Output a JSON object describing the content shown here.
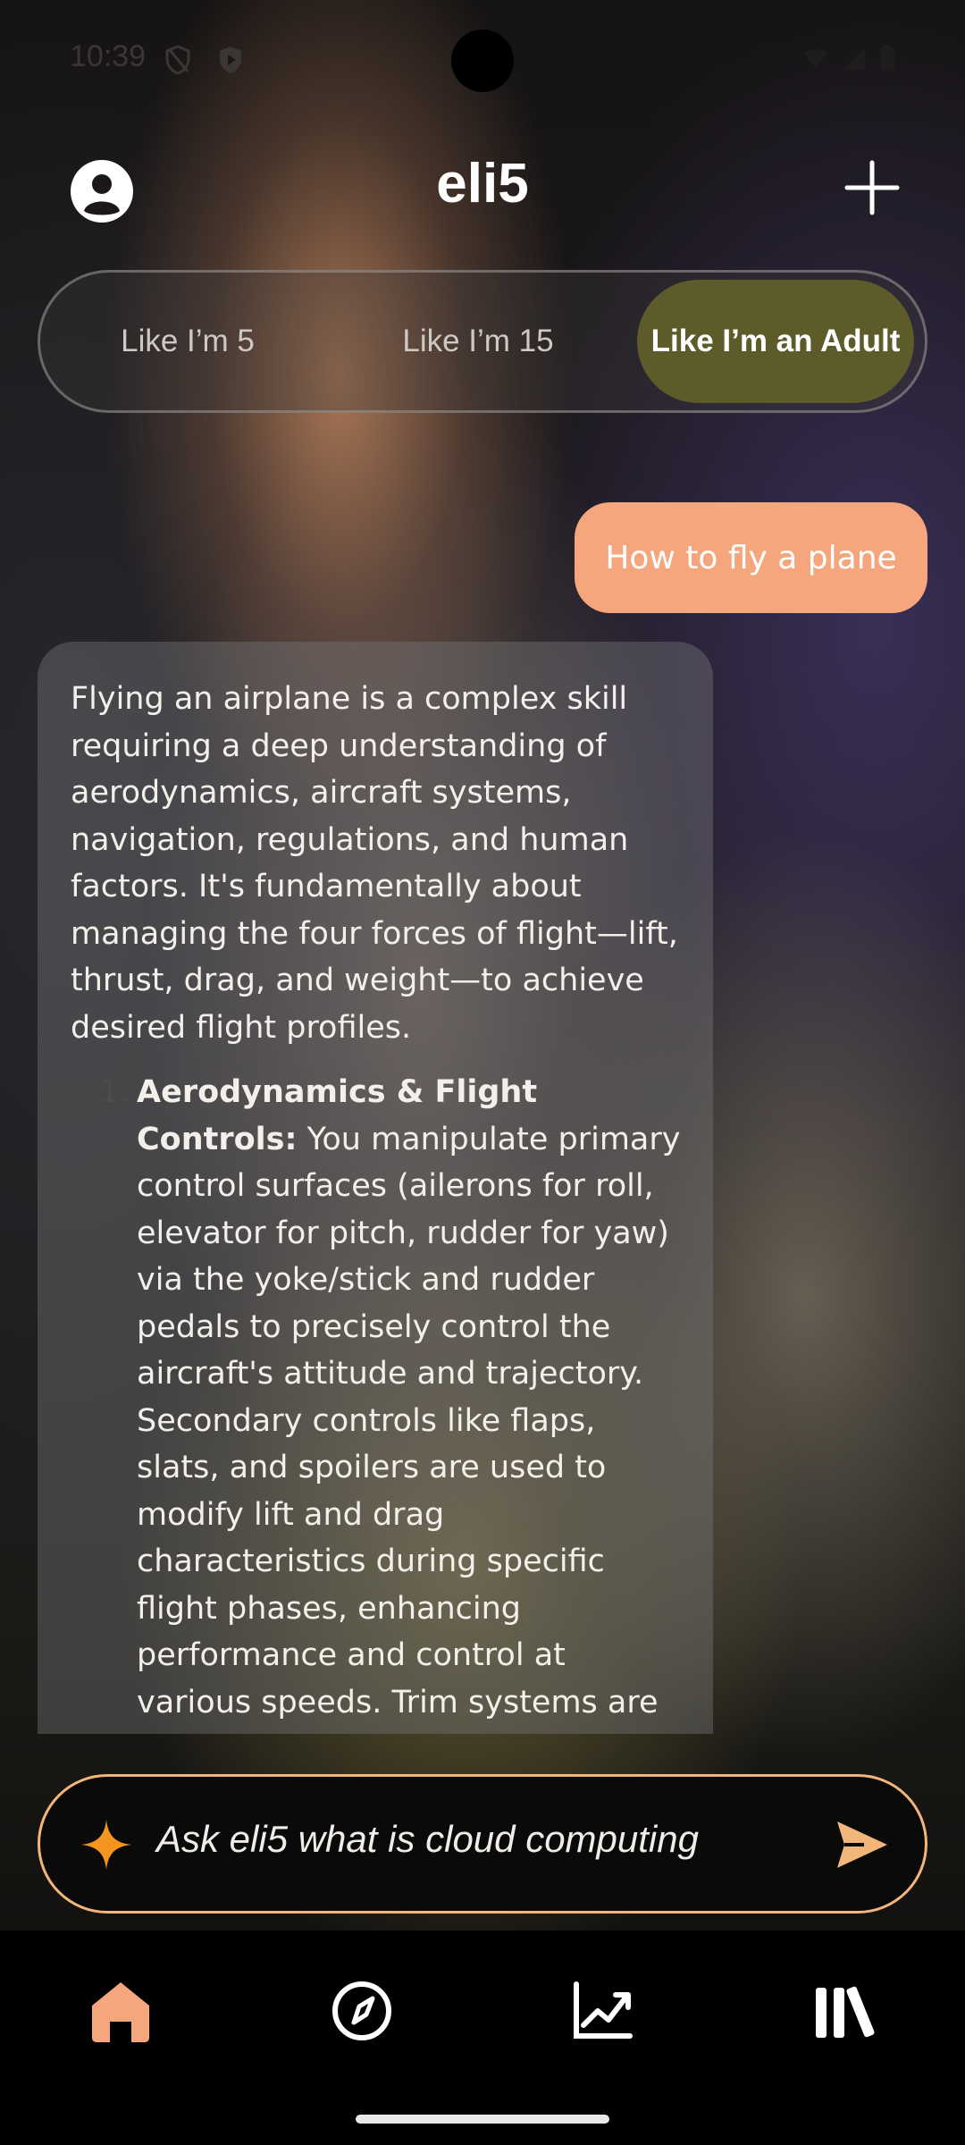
{
  "status_bar": {
    "time": "10:39",
    "icons": [
      "shield-outline-icon",
      "shield-play-icon",
      "wifi-icon",
      "signal-icon",
      "battery-icon"
    ]
  },
  "header": {
    "title": "eli5",
    "left_icon": "account-circle-icon",
    "right_icon": "plus-icon"
  },
  "levels": {
    "options": [
      "Like I’m 5",
      "Like I’m 15",
      "Like I’m an Adult"
    ],
    "selected": "Like I’m an Adult"
  },
  "chat": {
    "user_message": "How to fly a plane",
    "bot_intro": "Flying an airplane is a complex skill requiring a deep understanding of aerodynamics, aircraft systems, navigation, regulations, and human factors. It's fundamentally about managing the four forces of flight—lift, thrust, drag, and weight—to achieve desired flight profiles.",
    "bot_list": [
      {
        "number": "1.",
        "title": "Aerodynamics & Flight Controls:",
        "body": "You manipulate primary control surfaces (ailerons for roll, elevator for pitch, rudder for yaw) via the yoke/stick and rudder pedals to precisely control the aircraft's attitude and trajectory. Secondary controls like flaps, slats, and spoilers are used to modify lift and drag characteristics during specific flight phases, enhancing performance and control at various speeds. Trim systems are used to relieve control pressures."
      }
    ]
  },
  "input": {
    "placeholder": "Ask eli5 what is cloud computing",
    "icon": "sparkle-icon",
    "send_icon": "send-icon"
  },
  "nav": {
    "items": [
      "home-icon",
      "compass-icon",
      "trending-icon",
      "library-icon"
    ],
    "active": "home-icon"
  },
  "colors": {
    "accent": "#f5a67c",
    "selected_segment": "#5e5b2b",
    "input_border": "#f2b67a",
    "spark": "#f5941f"
  }
}
